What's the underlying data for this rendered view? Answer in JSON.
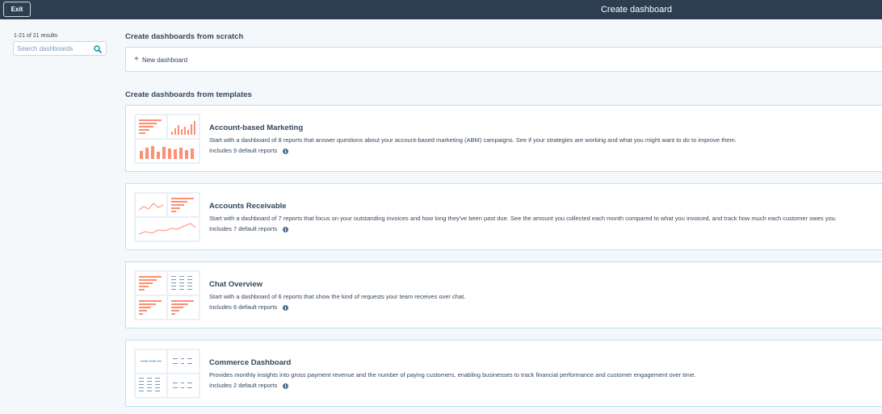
{
  "topbar": {
    "exit_label": "Exit",
    "title": "Create dashboard"
  },
  "sidebar": {
    "results_count": "1-21 of 21 results",
    "search_placeholder": "Search dashboards"
  },
  "sections": {
    "scratch_title": "Create dashboards from scratch",
    "templates_title": "Create dashboards from templates"
  },
  "new_dashboard": {
    "label": "New dashboard"
  },
  "templates": [
    {
      "title": "Account-based Marketing",
      "description": "Start with a dashboard of 8 reports that answer questions about your account-based marketing (ABM) campaigns. See if your strategies are working and what you might want to do to improve them.",
      "reports": "Includes 9 default reports"
    },
    {
      "title": "Accounts Receivable",
      "description": "Start with a dashboard of 7 reports that focus on your outstanding invoices and how long they've been past due. See the amount you collected each month compared to what you invoiced, and track how much each customer owes you.",
      "reports": "Includes 7 default reports"
    },
    {
      "title": "Chat Overview",
      "description": "Start with a dashboard of 6 reports that show the kind of requests your team receives over chat.",
      "reports": "Includes 6 default reports"
    },
    {
      "title": "Commerce Dashboard",
      "description": "Provides monthly insights into gross payment revenue and the number of paying customers, enabling businesses to track financial performance and customer engagement over time.",
      "reports": "Includes 2 default reports"
    }
  ],
  "colors": {
    "topbar": "#2d3e50",
    "chart_accent": "#ff8f73",
    "card_border": "#b9e3ee",
    "link_teal": "#0091ae"
  }
}
